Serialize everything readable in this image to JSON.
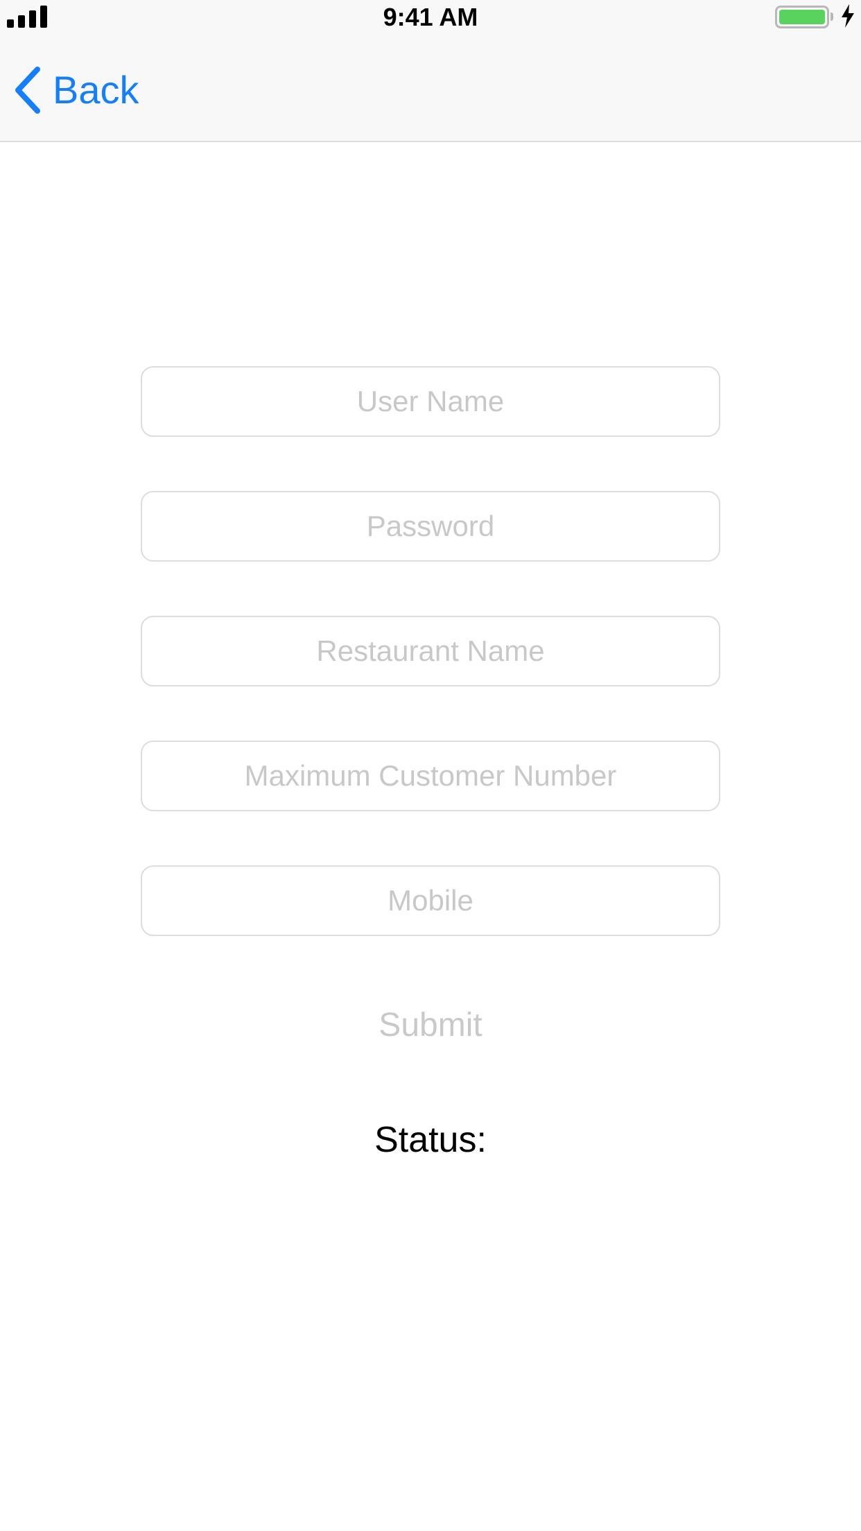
{
  "status_bar": {
    "time": "9:41 AM",
    "signal_icon": "cellular-signal-icon",
    "battery_icon": "battery-icon",
    "charging_icon": "lightning-bolt-icon",
    "battery_color": "#59d35d"
  },
  "nav": {
    "back_label": "Back",
    "back_icon": "chevron-left-icon",
    "accent_color": "#147efb"
  },
  "form": {
    "username": {
      "value": "",
      "placeholder": "User Name"
    },
    "password": {
      "value": "",
      "placeholder": "Password"
    },
    "restaurant_name": {
      "value": "",
      "placeholder": "Restaurant Name"
    },
    "max_customers": {
      "value": "",
      "placeholder": "Maximum Customer Number"
    },
    "mobile": {
      "value": "",
      "placeholder": "Mobile"
    },
    "submit_label": "Submit"
  },
  "status": {
    "label": "Status:"
  }
}
